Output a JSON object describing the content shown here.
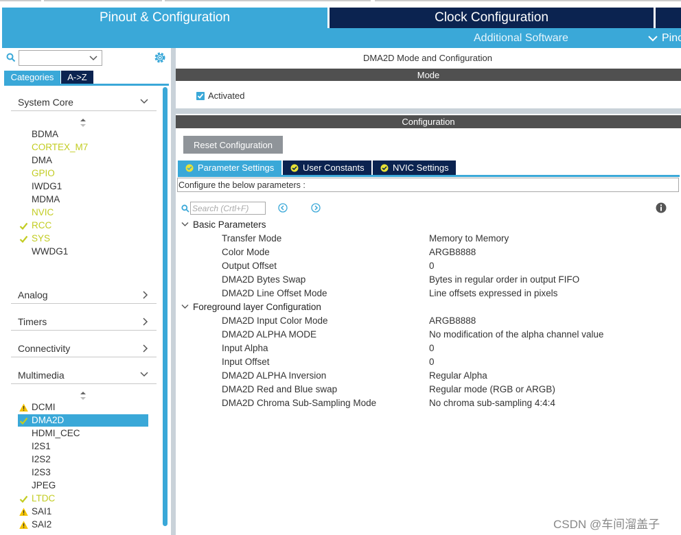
{
  "top_tabs": {
    "pinout": "Pinout & Configuration",
    "clock": "Clock Configuration"
  },
  "sub_bar": {
    "additional": "Additional Software",
    "pinout_view": "Pino"
  },
  "left": {
    "tabs": {
      "categories": "Categories",
      "az": "A->Z"
    },
    "categories": {
      "system_core": "System Core",
      "analog": "Analog",
      "timers": "Timers",
      "connectivity": "Connectivity",
      "multimedia": "Multimedia"
    },
    "system_core_items": [
      {
        "label": "BDMA",
        "color": "white",
        "icon": "none"
      },
      {
        "label": "CORTEX_M7",
        "color": "yellow",
        "icon": "none"
      },
      {
        "label": "DMA",
        "color": "white",
        "icon": "none"
      },
      {
        "label": "GPIO",
        "color": "yellow",
        "icon": "none"
      },
      {
        "label": "IWDG1",
        "color": "white",
        "icon": "none"
      },
      {
        "label": "MDMA",
        "color": "white",
        "icon": "none"
      },
      {
        "label": "NVIC",
        "color": "yellow",
        "icon": "none"
      },
      {
        "label": "RCC",
        "color": "yellow",
        "icon": "check-icon"
      },
      {
        "label": "SYS",
        "color": "yellow",
        "icon": "check-icon"
      },
      {
        "label": "WWDG1",
        "color": "white",
        "icon": "none"
      }
    ],
    "multimedia_items": [
      {
        "label": "DCMI",
        "color": "white",
        "icon": "warning-icon"
      },
      {
        "label": "DMA2D",
        "color": "selected",
        "icon": "check-icon"
      },
      {
        "label": "HDMI_CEC",
        "color": "white",
        "icon": "none"
      },
      {
        "label": "I2S1",
        "color": "white",
        "icon": "none"
      },
      {
        "label": "I2S2",
        "color": "white",
        "icon": "none"
      },
      {
        "label": "I2S3",
        "color": "white",
        "icon": "none"
      },
      {
        "label": "JPEG",
        "color": "white",
        "icon": "none"
      },
      {
        "label": "LTDC",
        "color": "yellow",
        "icon": "check-icon"
      },
      {
        "label": "SAI1",
        "color": "white",
        "icon": "warning-icon"
      },
      {
        "label": "SAI2",
        "color": "white",
        "icon": "warning-icon"
      }
    ]
  },
  "right": {
    "title": "DMA2D Mode and Configuration",
    "mode_header": "Mode",
    "activated_label": "Activated",
    "activated_checked": true,
    "config_header": "Configuration",
    "reset_button": "Reset Configuration",
    "tabs": {
      "params": "Parameter Settings",
      "constants": "User Constants",
      "nvic": "NVIC Settings"
    },
    "hint": "Configure the below parameters :",
    "search_placeholder": "Search (Crtl+F)",
    "groups": [
      {
        "title": "Basic Parameters",
        "rows": [
          {
            "key": "Transfer Mode",
            "value": "Memory to Memory"
          },
          {
            "key": "Color Mode",
            "value": "ARGB8888"
          },
          {
            "key": "Output Offset",
            "value": "0"
          },
          {
            "key": "DMA2D Bytes Swap",
            "value": "Bytes in regular order in output FIFO"
          },
          {
            "key": "DMA2D Line Offset Mode",
            "value": "Line offsets expressed in pixels"
          }
        ]
      },
      {
        "title": "Foreground layer Configuration",
        "rows": [
          {
            "key": "DMA2D Input Color Mode",
            "value": "ARGB8888"
          },
          {
            "key": "DMA2D ALPHA MODE",
            "value": "No modification of the alpha channel value"
          },
          {
            "key": "Input Alpha",
            "value": "0"
          },
          {
            "key": "Input Offset",
            "value": "0"
          },
          {
            "key": "DMA2D ALPHA Inversion",
            "value": "Regular Alpha"
          },
          {
            "key": "DMA2D Red and Blue swap",
            "value": "Regular mode (RGB or ARGB)"
          },
          {
            "key": "DMA2D Chroma Sub-Sampling Mode",
            "value": "No chroma sub-sampling 4:4:4"
          }
        ]
      }
    ]
  },
  "watermark": "CSDN @车间溜盖子",
  "colors": {
    "accent": "#3aa8d8",
    "navy": "#0b2350",
    "header_gray": "#505050",
    "enabled_yellow": "#c2cc21",
    "warning": "#f5c400"
  }
}
